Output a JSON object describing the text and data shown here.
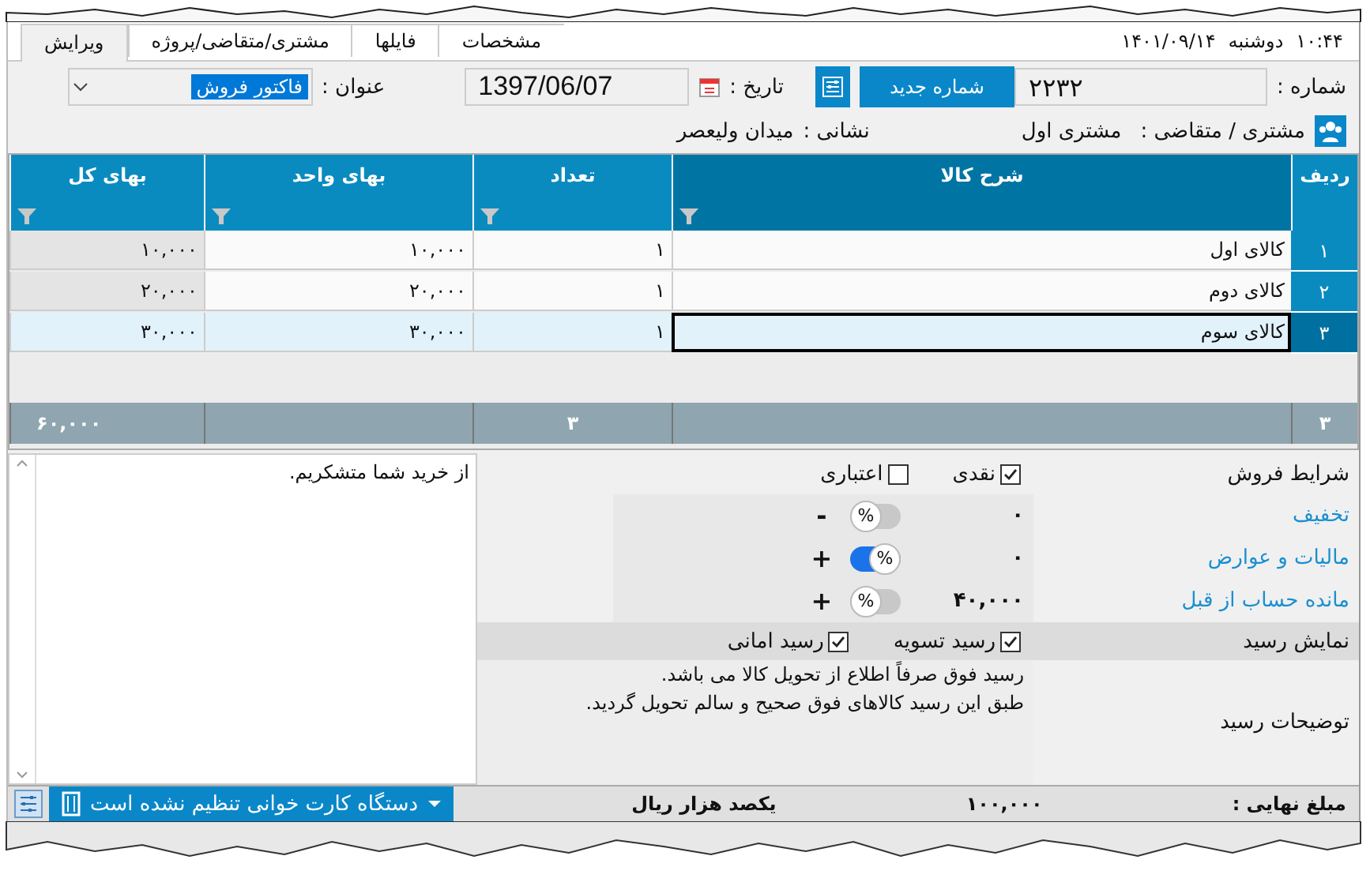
{
  "tabs": [
    {
      "label": "مشخصات",
      "selected": false
    },
    {
      "label": "فایلها",
      "selected": false
    },
    {
      "label": "مشتری/متقاضی/پروژه",
      "selected": false
    },
    {
      "label": "ویرایش",
      "selected": true
    }
  ],
  "clock": {
    "time": "۱۰:۴۴",
    "day": "دوشنبه",
    "date": "۱۴۰۱/۰۹/۱۴"
  },
  "header": {
    "number_label": "شماره :",
    "number": "۲۲۳۲",
    "new_number_button": "شماره جدید",
    "date_label": "تاریخ :",
    "date": "1397/06/07",
    "title_label": "عنوان :",
    "title": "فاکتور فروش"
  },
  "customer": {
    "label": "مشتری / متقاضی :",
    "name": "مشتری اول",
    "address_label": "نشانی :",
    "address": "میدان ولیعصر"
  },
  "table": {
    "columns": [
      "ردیف",
      "شرح کالا",
      "تعداد",
      "بهای واحد",
      "بهای کل"
    ],
    "rows": [
      {
        "cells": [
          "۱",
          "کالای اول",
          "۱",
          "۱۰,۰۰۰",
          "۱۰,۰۰۰"
        ],
        "selected": false
      },
      {
        "cells": [
          "۲",
          "کالای دوم",
          "۱",
          "۲۰,۰۰۰",
          "۲۰,۰۰۰"
        ],
        "selected": false
      },
      {
        "cells": [
          "۳",
          "کالای سوم",
          "۱",
          "۳۰,۰۰۰",
          "۳۰,۰۰۰"
        ],
        "selected": true
      }
    ],
    "totals": {
      "row_count": "۳",
      "quantity": "۳",
      "total": "۶۰,۰۰۰"
    }
  },
  "notes": "از خرید شما متشکریم.",
  "sale_terms": {
    "label": "شرایط فروش",
    "options": [
      {
        "label": "نقدی",
        "checked": true
      },
      {
        "label": "اعتباری",
        "checked": false
      }
    ]
  },
  "adjustments": [
    {
      "label": "تخفیف",
      "value": "۰",
      "percent_symbol": "%",
      "percent_on": false,
      "sign": "-"
    },
    {
      "label": "مالیات و عوارض",
      "value": "۰",
      "percent_symbol": "%",
      "percent_on": true,
      "sign": "+"
    },
    {
      "label": "مانده حساب از قبل",
      "value": "۴۰,۰۰۰",
      "percent_symbol": "%",
      "percent_on": false,
      "sign": "+"
    }
  ],
  "receipt": {
    "label": "نمایش رسید",
    "options": [
      {
        "label": "رسید تسویه",
        "checked": true
      },
      {
        "label": "رسید امانی",
        "checked": true
      }
    ]
  },
  "receipt_notes": {
    "label": "توضیحات رسید",
    "lines": [
      "رسید فوق صرفاً اطلاع از تحویل کالا می باشد.",
      "طبق این رسید کالاهای فوق صحیح و سالم تحویل گردید."
    ]
  },
  "footer": {
    "final_label": "مبلغ نهایی :",
    "amount": "۱۰۰,۰۰۰",
    "words": "یکصد هزار ریال",
    "card_reader": "دستگاه کارت خوانی تنظیم نشده است"
  }
}
